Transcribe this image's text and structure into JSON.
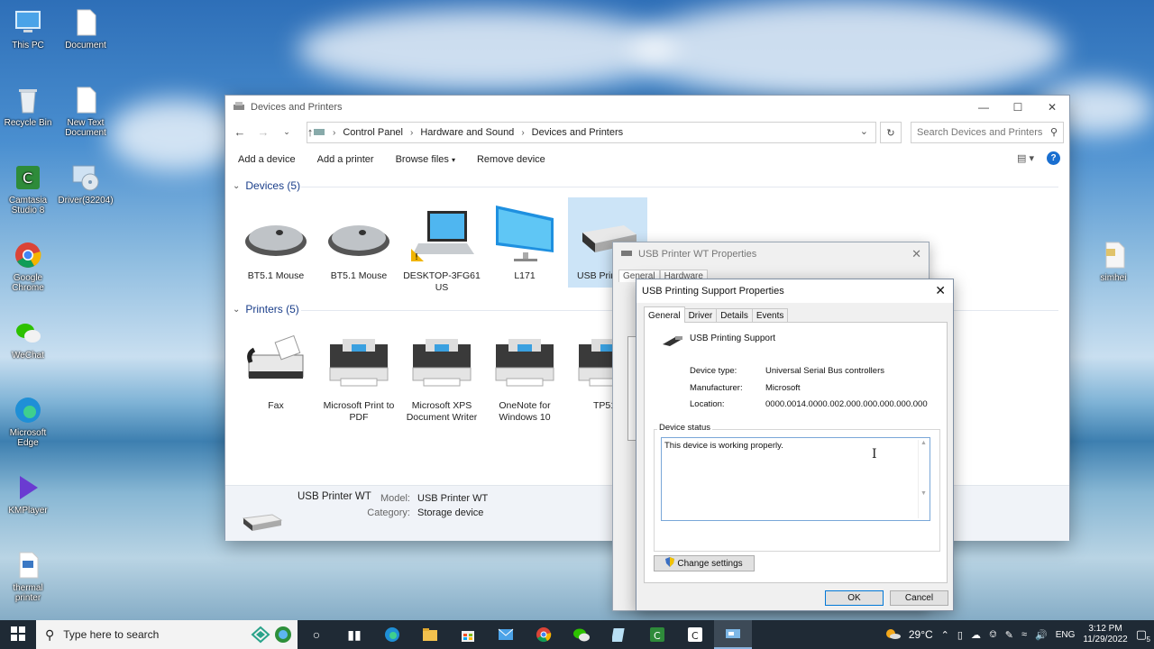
{
  "desktop": {
    "icons": [
      {
        "label": "This PC",
        "icon": "computer-icon"
      },
      {
        "label": "Document",
        "icon": "file-icon"
      },
      {
        "label": "Recycle Bin",
        "icon": "recycle-bin-icon"
      },
      {
        "label": "New Text Document",
        "icon": "text-file-icon"
      },
      {
        "label": "Camtasia Studio 8",
        "icon": "camtasia-icon"
      },
      {
        "label": "Driver(32204)",
        "icon": "cd-drive-icon"
      },
      {
        "label": "Google Chrome",
        "icon": "chrome-icon"
      },
      {
        "label": "WeChat",
        "icon": "wechat-icon"
      },
      {
        "label": "Microsoft Edge",
        "icon": "edge-icon"
      },
      {
        "label": "KMPlayer",
        "icon": "kmplayer-icon"
      },
      {
        "label": "thermal printer",
        "icon": "document-icon"
      },
      {
        "label": "simhei",
        "icon": "font-file-icon"
      }
    ]
  },
  "explorer": {
    "title": "Devices and Printers",
    "breadcrumb": [
      "Control Panel",
      "Hardware and Sound",
      "Devices and Printers"
    ],
    "search_placeholder": "Search Devices and Printers",
    "toolbar": {
      "add_device": "Add a device",
      "add_printer": "Add a printer",
      "browse_files": "Browse files",
      "remove_device": "Remove device",
      "help": "?"
    },
    "devices_header": "Devices (5)",
    "devices": [
      {
        "name": "BT5.1 Mouse",
        "icon": "mouse-icon"
      },
      {
        "name": "BT5.1 Mouse",
        "icon": "mouse-icon"
      },
      {
        "name": "DESKTOP-3FG61 US",
        "icon": "laptop-icon"
      },
      {
        "name": "L171",
        "icon": "monitor-icon"
      },
      {
        "name": "USB Print",
        "icon": "usb-device-icon"
      }
    ],
    "printers_header": "Printers (5)",
    "printers": [
      {
        "name": "Fax",
        "icon": "fax-icon"
      },
      {
        "name": "Microsoft Print to PDF",
        "icon": "printer-icon"
      },
      {
        "name": "Microsoft XPS Document Writer",
        "icon": "printer-icon"
      },
      {
        "name": "OneNote for Windows 10",
        "icon": "printer-icon"
      },
      {
        "name": "TP51",
        "icon": "printer-icon"
      }
    ],
    "details": {
      "name": "USB Printer WT",
      "model_label": "Model:",
      "model_value": "USB Printer WT",
      "category_label": "Category:",
      "category_value": "Storage device"
    }
  },
  "prop_back": {
    "title": "USB Printer WT Properties",
    "tabs": [
      "General",
      "Hardware"
    ]
  },
  "prop_front": {
    "title": "USB Printing Support Properties",
    "tabs": [
      "General",
      "Driver",
      "Details",
      "Events"
    ],
    "active_tab": "General",
    "device_name": "USB Printing Support",
    "device_type_label": "Device type:",
    "device_type_value": "Universal Serial Bus controllers",
    "manufacturer_label": "Manufacturer:",
    "manufacturer_value": "Microsoft",
    "location_label": "Location:",
    "location_value": "0000.0014.0000.002.000.000.000.000.000",
    "status_group": "Device status",
    "status_text": "This device is working properly.",
    "change_settings": "Change settings",
    "ok": "OK",
    "cancel": "Cancel"
  },
  "taskbar": {
    "search_text": "Type here to search",
    "weather": "29°C",
    "language": "ENG",
    "time": "3:12 PM",
    "date": "11/29/2022",
    "notification_count": "5"
  }
}
